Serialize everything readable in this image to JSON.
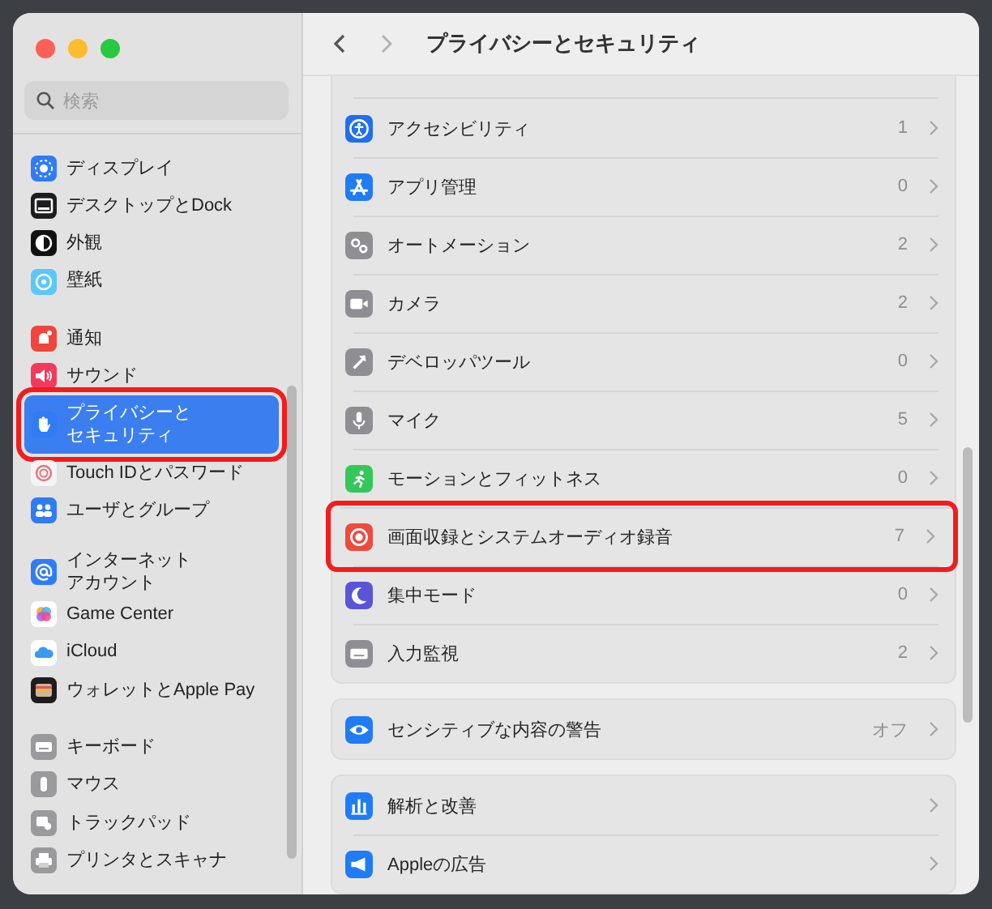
{
  "window": {
    "title": "プライバシーとセキュリティ"
  },
  "search": {
    "placeholder": "検索"
  },
  "sidebar": {
    "groups": [
      {
        "items": [
          {
            "label": "ディスプレイ",
            "selected": false,
            "highlighted": false
          },
          {
            "label": "デスクトップとDock",
            "selected": false,
            "highlighted": false
          },
          {
            "label": "外観",
            "selected": false,
            "highlighted": false
          },
          {
            "label": "壁紙",
            "selected": false,
            "highlighted": false
          }
        ]
      },
      {
        "items": [
          {
            "label": "通知",
            "selected": false,
            "highlighted": false
          },
          {
            "label": "サウンド",
            "selected": false,
            "highlighted": false
          },
          {
            "label": "プライバシーとセキュリティ",
            "selected": true,
            "highlighted": true
          },
          {
            "label": "Touch IDとパスワード",
            "selected": false,
            "highlighted": false
          },
          {
            "label": "ユーザとグループ",
            "selected": false,
            "highlighted": false
          }
        ]
      },
      {
        "items": [
          {
            "label": "インターネットアカウント",
            "selected": false,
            "highlighted": false
          },
          {
            "label": "Game Center",
            "selected": false,
            "highlighted": false
          },
          {
            "label": "iCloud",
            "selected": false,
            "highlighted": false
          },
          {
            "label": "ウォレットとApple Pay",
            "selected": false,
            "highlighted": false
          }
        ]
      },
      {
        "items": [
          {
            "label": "キーボード",
            "selected": false,
            "highlighted": false
          },
          {
            "label": "マウス",
            "selected": false,
            "highlighted": false
          },
          {
            "label": "トラックパッド",
            "selected": false,
            "highlighted": false
          },
          {
            "label": "プリンタとスキャナ",
            "selected": false,
            "highlighted": false
          }
        ]
      }
    ]
  },
  "sections": [
    {
      "rows": [
        {
          "label": "アクセシビリティ",
          "value": "1",
          "highlighted": false
        },
        {
          "label": "アプリ管理",
          "value": "0",
          "highlighted": false
        },
        {
          "label": "オートメーション",
          "value": "2",
          "highlighted": false
        },
        {
          "label": "カメラ",
          "value": "2",
          "highlighted": false
        },
        {
          "label": "デベロッパツール",
          "value": "0",
          "highlighted": false
        },
        {
          "label": "マイク",
          "value": "5",
          "highlighted": false
        },
        {
          "label": "モーションとフィットネス",
          "value": "0",
          "highlighted": false
        },
        {
          "label": "画面収録とシステムオーディオ録音",
          "value": "7",
          "highlighted": true
        },
        {
          "label": "集中モード",
          "value": "0",
          "highlighted": false
        },
        {
          "label": "入力監視",
          "value": "2",
          "highlighted": false
        }
      ]
    },
    {
      "rows": [
        {
          "label": "センシティブな内容の警告",
          "value": "オフ",
          "highlighted": false
        }
      ]
    },
    {
      "rows": [
        {
          "label": "解析と改善",
          "highlighted": false
        },
        {
          "label": "Appleの広告",
          "highlighted": false
        }
      ]
    }
  ]
}
